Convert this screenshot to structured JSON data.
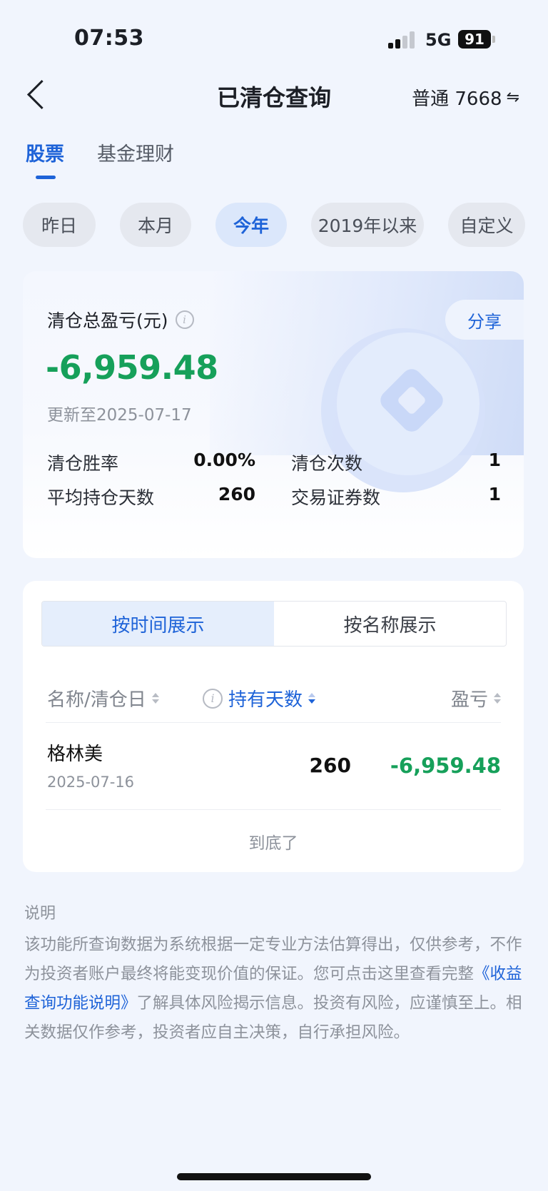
{
  "status_bar": {
    "time": "07:53",
    "network": "5G",
    "battery": "91"
  },
  "nav": {
    "title": "已清仓查询",
    "account": "普通 7668",
    "swap_icon": "⇋"
  },
  "tabs": [
    {
      "label": "股票",
      "active": true
    },
    {
      "label": "基金理财",
      "active": false
    }
  ],
  "periods": [
    {
      "label": "昨日"
    },
    {
      "label": "本月"
    },
    {
      "label": "今年",
      "active": true
    },
    {
      "label": "2019年以来"
    },
    {
      "label": "自定义"
    }
  ],
  "summary": {
    "label": "清仓总盈亏(元)",
    "info_icon": "i",
    "share": "分享",
    "total": "-6,959.48",
    "updated": "更新至2025-07-17",
    "stats": [
      {
        "label": "清仓胜率",
        "value": "0.00%"
      },
      {
        "label": "清仓次数",
        "value": "1"
      },
      {
        "label": "平均持仓天数",
        "value": "260"
      },
      {
        "label": "交易证券数",
        "value": "1"
      }
    ]
  },
  "list": {
    "segments": [
      {
        "label": "按时间展示",
        "active": true
      },
      {
        "label": "按名称展示"
      }
    ],
    "columns": {
      "name": "名称/清仓日",
      "days": "持有天数",
      "pl": "盈亏"
    },
    "rows": [
      {
        "name": "格林美",
        "date": "2025-07-16",
        "days": "260",
        "pl": "-6,959.48"
      }
    ],
    "end_text": "到底了"
  },
  "notes": {
    "title": "说明",
    "text_before": "该功能所查询数据为系统根据一定专业方法估算得出，仅供参考，不作为投资者账户最终将能变现价值的保证。您可点击这里查看完整",
    "link": "《收益查询功能说明》",
    "text_after": "了解具体风险揭示信息。投资有风险，应谨慎至上。相关数据仅作参考，投资者应自主决策，自行承担风险。"
  },
  "colors": {
    "accent": "#1e63d8",
    "loss": "#16a05a",
    "background": "#f1f5fd"
  }
}
